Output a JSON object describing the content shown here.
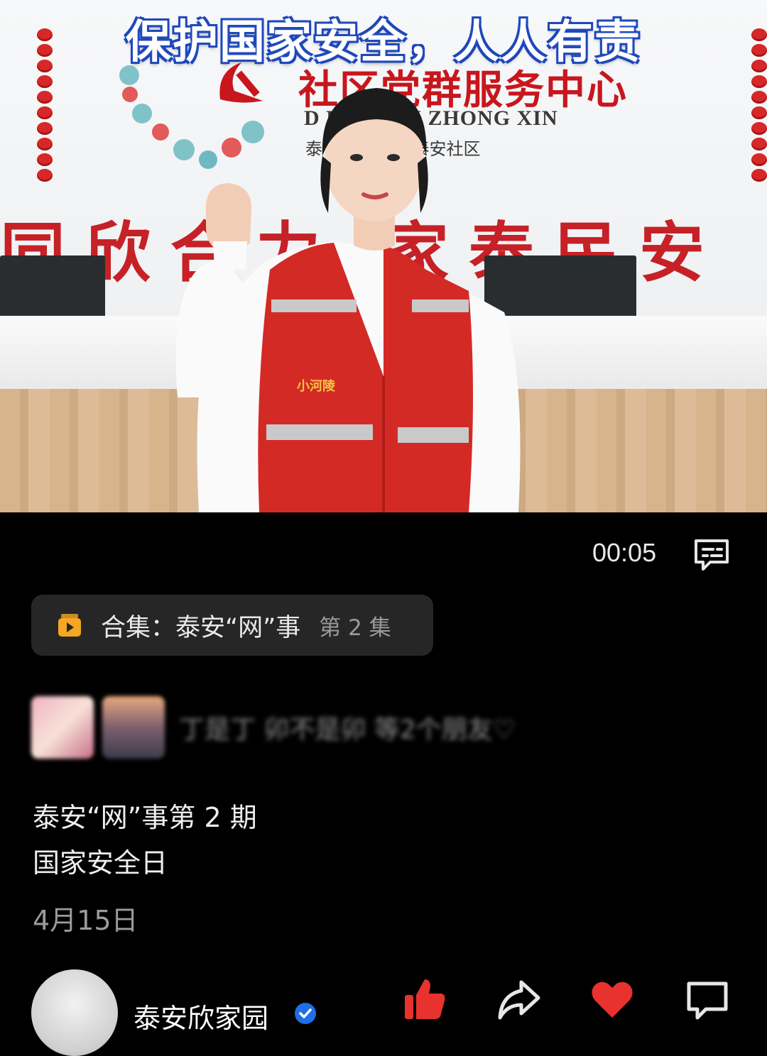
{
  "video": {
    "headline": "保护国家安全，人人有责",
    "sign_title": "社区党群服务中心",
    "sign_pinyin": "D      N FU WU ZHONG XIN",
    "sign_sub": "泰    泰路街道 · 泰安社区",
    "wall_slogan": "同欣合力 家泰民安",
    "vest_text": "小河陵",
    "current_time": "00:05"
  },
  "collection": {
    "label": "合集：泰安“网”事",
    "episode": "第 2 集"
  },
  "friends": {
    "text": "丁是丁 卯不是卯 等2个朋友♡"
  },
  "post": {
    "line1": "泰安“网”事第 2 期",
    "line2": "国家安全日",
    "date": "4月15日"
  },
  "author": {
    "name": "泰安欣家园"
  },
  "icons": {
    "danmu": "danmu-icon",
    "collection": "playlist-icon",
    "verified": "verified-badge-icon",
    "like": "thumbs-up-icon",
    "share": "share-icon",
    "favorite": "heart-icon",
    "comment": "comment-icon"
  },
  "colors": {
    "background": "#000000",
    "accent_orange": "#f5a623",
    "like_red": "#e8322e",
    "verify_blue": "#1e6fe8"
  }
}
